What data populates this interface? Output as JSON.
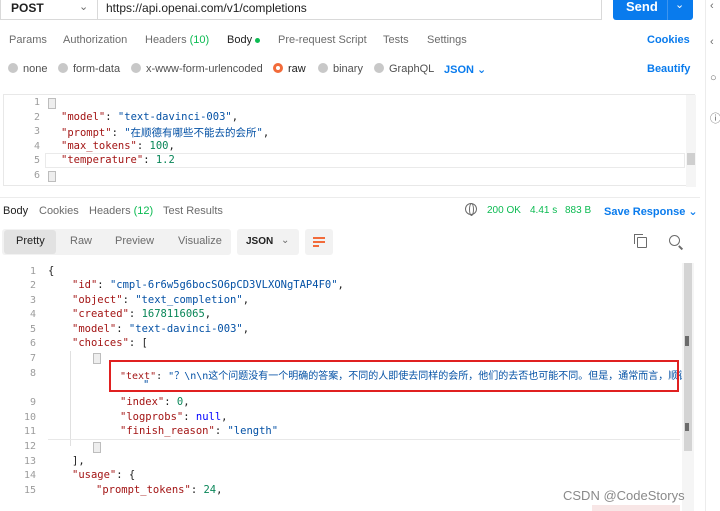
{
  "request": {
    "method": "POST",
    "url": "https://api.openai.com/v1/completions",
    "send_label": "Send"
  },
  "request_tabs": {
    "params": "Params",
    "authorization": "Authorization",
    "headers": "Headers",
    "headers_count": "(10)",
    "body": "Body",
    "pre_request": "Pre-request Script",
    "tests": "Tests",
    "settings": "Settings",
    "cookies": "Cookies"
  },
  "body_types": {
    "none": "none",
    "form_data": "form-data",
    "urlencoded": "x-www-form-urlencoded",
    "raw": "raw",
    "binary": "binary",
    "graphql": "GraphQL",
    "format": "JSON",
    "beautify": "Beautify"
  },
  "request_body": {
    "line_numbers": [
      "1",
      "2",
      "3",
      "4",
      "5",
      "6"
    ],
    "line2_key": "\"model\"",
    "line2_value": "\"text-davinci-003\"",
    "line3_key": "\"prompt\"",
    "line3_value": "\"在顺德有哪些不能去的会所\"",
    "line4_key": "\"max_tokens\"",
    "line4_value": "100",
    "line5_key": "\"temperature\"",
    "line5_value": "1.2"
  },
  "response_tabs": {
    "body": "Body",
    "cookies": "Cookies",
    "headers": "Headers",
    "headers_count": "(12)",
    "test_results": "Test Results",
    "status": "200 OK",
    "time": "4.41 s",
    "size": "883 B",
    "save_response": "Save Response"
  },
  "view_bar": {
    "pretty": "Pretty",
    "raw": "Raw",
    "preview": "Preview",
    "visualize": "Visualize",
    "format": "JSON"
  },
  "response_body": {
    "line_numbers": [
      "1",
      "2",
      "3",
      "4",
      "5",
      "6",
      "7",
      "8",
      "9",
      "10",
      "11",
      "12",
      "13",
      "14",
      "15"
    ],
    "id_key": "\"id\"",
    "id_value": "\"cmpl-6r6w5g6bocSO6pCD3VLXONgTAP4F0\"",
    "object_key": "\"object\"",
    "object_value": "\"text_completion\"",
    "created_key": "\"created\"",
    "created_value": "1678116065",
    "model_key": "\"model\"",
    "model_value": "\"text-davinci-003\"",
    "choices_key": "\"choices\"",
    "text_key": "\"text\"",
    "text_value": "\"？\\n\\n这个问题没有一个明确的答案，不同的人即使去同样的会所，他们的去否也可能不同。但是，通常而言，顺德",
    "text_cont": "\"",
    "index_key": "\"index\"",
    "index_value": "0",
    "logprobs_key": "\"logprobs\"",
    "logprobs_value": "null",
    "finish_key": "\"finish_reason\"",
    "finish_value": "\"length\"",
    "usage_key": "\"usage\"",
    "prompt_tokens_key": "\"prompt_tokens\"",
    "prompt_tokens_value": "24"
  },
  "watermark": "CSDN @CodeStorys",
  "colors": {
    "accent": "#097bed",
    "status_ok": "#0cbb52",
    "highlight": "#e02020",
    "radio_on": "#f26b3a"
  }
}
